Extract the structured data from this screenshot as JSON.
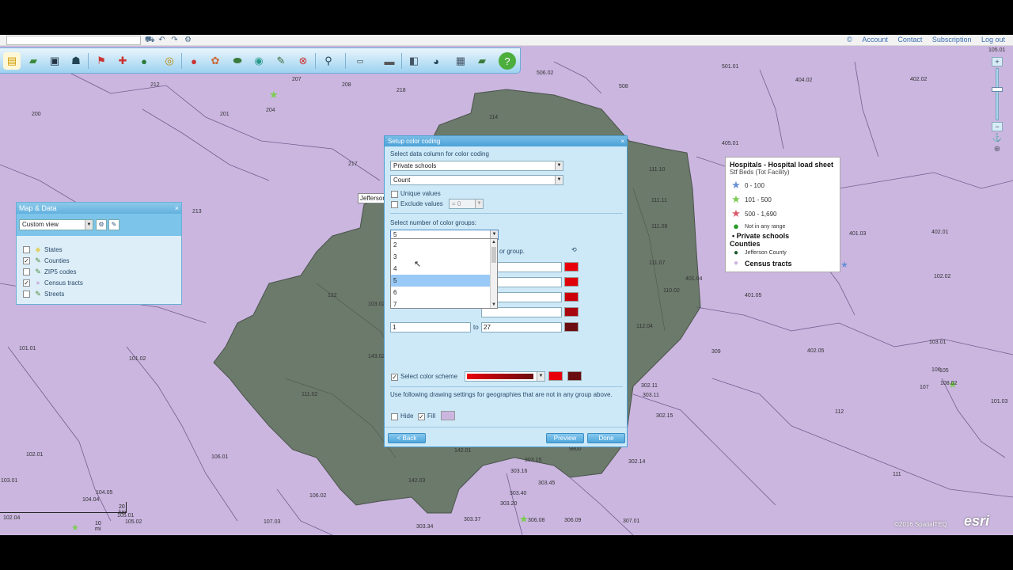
{
  "toplinks": [
    "Account",
    "Contact",
    "Subscription",
    "Log out"
  ],
  "toolbar": {
    "icons": [
      "new-icon",
      "open-icon",
      "save-icon",
      "people-icon",
      "pushpin-icon",
      "puzzle-icon",
      "globe-icon",
      "target-icon",
      "colorcode-icon",
      "layers-icon",
      "territory-icon",
      "ring-icon",
      "route-icon",
      "delete-icon",
      "search-icon",
      "text-icon",
      "ruler-icon",
      "print-icon",
      "export-icon",
      "grid-icon",
      "data-icon",
      "help-icon"
    ]
  },
  "map_labels": [
    {
      "t": "212"
    },
    {
      "t": "207"
    },
    {
      "t": "208"
    },
    {
      "t": "204"
    },
    {
      "t": "200"
    },
    {
      "t": "201"
    },
    {
      "t": "213"
    },
    {
      "t": "217"
    },
    {
      "t": "218"
    },
    {
      "t": "114"
    },
    {
      "t": "506.02"
    },
    {
      "t": "508"
    },
    {
      "t": "501.01"
    },
    {
      "t": "404.02"
    },
    {
      "t": "402.02"
    },
    {
      "t": "405.01"
    },
    {
      "t": "111.10"
    },
    {
      "t": "111.11"
    },
    {
      "t": "111.09"
    },
    {
      "t": "111.07"
    },
    {
      "t": "401.04"
    },
    {
      "t": "401.03"
    },
    {
      "t": "402.01"
    },
    {
      "t": "101.01"
    },
    {
      "t": "102.02"
    },
    {
      "t": "103.01"
    },
    {
      "t": "401.05"
    },
    {
      "t": "111.02"
    },
    {
      "t": "112.04"
    },
    {
      "t": "309"
    },
    {
      "t": "402.05"
    },
    {
      "t": "101.03"
    },
    {
      "t": "101.02"
    },
    {
      "t": "105"
    },
    {
      "t": "106"
    },
    {
      "t": "107"
    },
    {
      "t": "108.02"
    },
    {
      "t": "112"
    },
    {
      "t": "302.15"
    },
    {
      "t": "303.11"
    },
    {
      "t": "302.14"
    },
    {
      "t": "111"
    },
    {
      "t": "102.01"
    },
    {
      "t": "103.01"
    },
    {
      "t": "106.01"
    },
    {
      "t": "106.02"
    },
    {
      "t": "107.03"
    },
    {
      "t": "104.05"
    },
    {
      "t": "142.01"
    },
    {
      "t": "142.03"
    },
    {
      "t": "303.15"
    },
    {
      "t": "303.16"
    },
    {
      "t": "303.45"
    },
    {
      "t": "303.40"
    },
    {
      "t": "303.20"
    },
    {
      "t": "303.34"
    },
    {
      "t": "303.37"
    },
    {
      "t": "306.08"
    },
    {
      "t": "306.09"
    },
    {
      "t": "307.01"
    },
    {
      "t": "9800"
    },
    {
      "t": "122"
    },
    {
      "t": "103.02"
    },
    {
      "t": "143.02"
    },
    {
      "t": "302.11"
    },
    {
      "t": "105.01"
    },
    {
      "t": "105.02"
    },
    {
      "t": "110.02"
    },
    {
      "t": "104.04"
    },
    {
      "t": "102.04"
    },
    {
      "t": "101.02"
    }
  ],
  "jefferson_label": "Jeffersor",
  "zoom": {
    "scale_top": "105.01"
  },
  "legend": {
    "title": "Hospitals - Hospital load sheet",
    "subtitle": "Stf Beds (Tot Facility)",
    "rows": [
      {
        "label": "0 - 100",
        "color": "#6a8fd6",
        "icon": "star-icon"
      },
      {
        "label": "101 - 500",
        "color": "#7ccc52",
        "icon": "star-icon"
      },
      {
        "label": "500 - 1,690",
        "color": "#d9576a",
        "icon": "star-icon"
      },
      {
        "label": "Not in any range",
        "color": "#2a9a2a",
        "icon": "circle-icon"
      }
    ],
    "private_schools": "Private schools",
    "counties": "Counties",
    "jefferson": "Jefferson County",
    "census": "Census tracts"
  },
  "map_data_panel": {
    "title": "Map & Data",
    "close": "×",
    "view": "Custom view",
    "layers": [
      {
        "label": "States",
        "checked": false
      },
      {
        "label": "Counties",
        "checked": true
      },
      {
        "label": "ZIP5 codes",
        "checked": false
      },
      {
        "label": "Census tracts",
        "checked": true
      },
      {
        "label": "Streets",
        "checked": false
      }
    ]
  },
  "dialog": {
    "title": "Setup color coding",
    "close": "×",
    "select_column_label": "Select data column for color coding",
    "column_value": "Private schools",
    "agg_value": "Count",
    "unique_values": "Unique values",
    "exclude_values": "Exclude values",
    "exclude_input": "= 0",
    "num_groups_label": "Select number of color groups:",
    "num_groups_value": "5",
    "for_group_text": "or group.",
    "last_row": {
      "from": "1",
      "to_label": "to",
      "to": "27"
    },
    "select_scheme": "Select color scheme",
    "drawing_note": "Use following drawing settings for geographies that are not in any group above.",
    "hide": "Hide",
    "fill": "Fill",
    "back": "< Back",
    "preview": "Preview",
    "done": "Done",
    "group_colors": [
      "#e8000b",
      "#e00009",
      "#cc0008",
      "#a80710",
      "#6a0c10"
    ],
    "scheme_colors": [
      "#e8000b",
      "#6a0c10"
    ],
    "fill_color": "#cbb6e0"
  },
  "dropdown_options": [
    "2",
    "3",
    "4",
    "5",
    "6",
    "7"
  ],
  "dropdown_selected": "5",
  "scale": {
    "km": "20 km",
    "mi": "10 mi"
  },
  "copyright": "©2016 SpatialTEQ",
  "esri": "esri"
}
